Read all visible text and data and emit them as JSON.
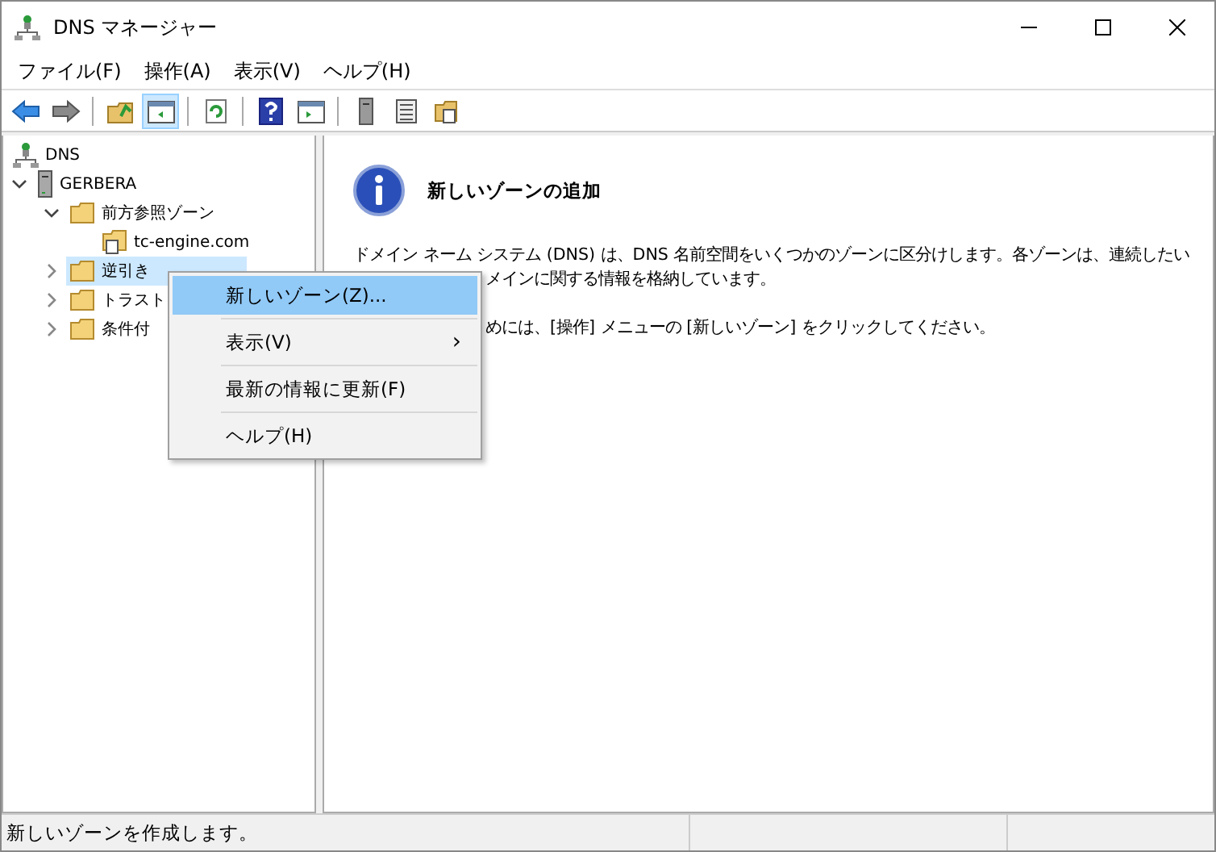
{
  "window": {
    "title": "DNS マネージャー"
  },
  "menu_bar": [
    "ファイル(F)",
    "操作(A)",
    "表示(V)",
    "ヘルプ(H)"
  ],
  "toolbar": [
    {
      "kind": "back",
      "pressed": false
    },
    {
      "kind": "forward",
      "pressed": false
    },
    {
      "kind": "separator"
    },
    {
      "kind": "up",
      "pressed": false
    },
    {
      "kind": "tree",
      "pressed": true
    },
    {
      "kind": "separator"
    },
    {
      "kind": "refresh",
      "pressed": false
    },
    {
      "kind": "separator"
    },
    {
      "kind": "help",
      "pressed": false
    },
    {
      "kind": "action",
      "pressed": false
    },
    {
      "kind": "separator"
    },
    {
      "kind": "server",
      "pressed": false
    },
    {
      "kind": "list",
      "pressed": false
    },
    {
      "kind": "properties",
      "pressed": false
    }
  ],
  "tree": [
    {
      "label": "DNS",
      "kind": "dns",
      "selected": false,
      "children": [
        {
          "label": "GERBERA",
          "kind": "server",
          "expanded": true,
          "selected": false,
          "children": [
            {
              "label": "前方参照ゾーン",
              "kind": "folder",
              "expanded": true,
              "selected": false,
              "children": [
                {
                  "label": "tc-engine.com",
                  "kind": "zone",
                  "selected": false
                }
              ]
            },
            {
              "label": "逆引き",
              "kind": "folder",
              "expanded": false,
              "selected": true
            },
            {
              "label": "トラスト",
              "kind": "folder",
              "expanded": false,
              "selected": false
            },
            {
              "label": "条件付",
              "kind": "folder",
              "expanded": false,
              "selected": false
            }
          ]
        }
      ]
    }
  ],
  "detail": {
    "heading": "新しいゾーンの追加",
    "lines": [
      "ドメイン ネーム システム (DNS) は、DNS 名前空間をいくつかのゾーンに区分けします。各ゾーンは、連続したい",
      "メインに関する情報を格納しています。",
      "めには、[操作] メニューの [新しいゾーン] をクリックしてください。"
    ]
  },
  "context_menu": [
    {
      "label": "新しいゾーン(Z)...",
      "selected": true
    },
    {
      "label": "表示(V)",
      "submenu": "›",
      "selected": false
    },
    {
      "label": "最新の情報に更新(F)",
      "selected": false
    },
    {
      "label": "ヘルプ(H)",
      "selected": false
    }
  ],
  "status_bar": {
    "text": "新しいゾーンを作成します。"
  }
}
